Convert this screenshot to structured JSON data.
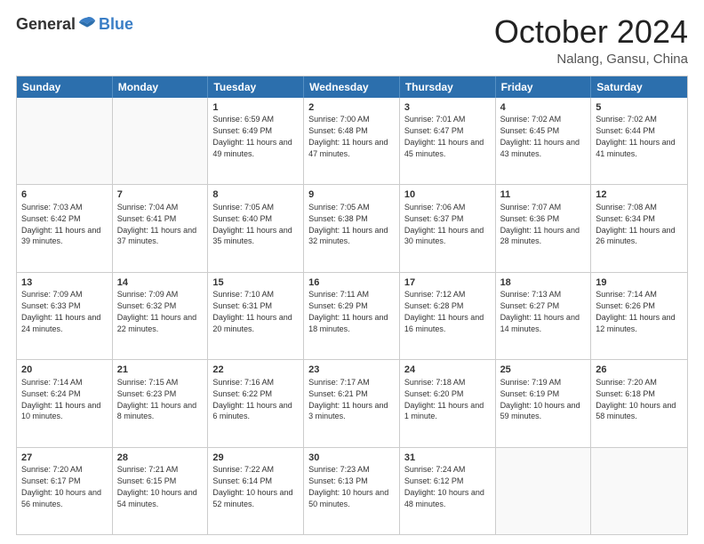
{
  "header": {
    "logo_general": "General",
    "logo_blue": "Blue",
    "month_title": "October 2024",
    "location": "Nalang, Gansu, China"
  },
  "days_of_week": [
    "Sunday",
    "Monday",
    "Tuesday",
    "Wednesday",
    "Thursday",
    "Friday",
    "Saturday"
  ],
  "weeks": [
    [
      {
        "day": "",
        "text": ""
      },
      {
        "day": "",
        "text": ""
      },
      {
        "day": "1",
        "text": "Sunrise: 6:59 AM\nSunset: 6:49 PM\nDaylight: 11 hours and 49 minutes."
      },
      {
        "day": "2",
        "text": "Sunrise: 7:00 AM\nSunset: 6:48 PM\nDaylight: 11 hours and 47 minutes."
      },
      {
        "day": "3",
        "text": "Sunrise: 7:01 AM\nSunset: 6:47 PM\nDaylight: 11 hours and 45 minutes."
      },
      {
        "day": "4",
        "text": "Sunrise: 7:02 AM\nSunset: 6:45 PM\nDaylight: 11 hours and 43 minutes."
      },
      {
        "day": "5",
        "text": "Sunrise: 7:02 AM\nSunset: 6:44 PM\nDaylight: 11 hours and 41 minutes."
      }
    ],
    [
      {
        "day": "6",
        "text": "Sunrise: 7:03 AM\nSunset: 6:42 PM\nDaylight: 11 hours and 39 minutes."
      },
      {
        "day": "7",
        "text": "Sunrise: 7:04 AM\nSunset: 6:41 PM\nDaylight: 11 hours and 37 minutes."
      },
      {
        "day": "8",
        "text": "Sunrise: 7:05 AM\nSunset: 6:40 PM\nDaylight: 11 hours and 35 minutes."
      },
      {
        "day": "9",
        "text": "Sunrise: 7:05 AM\nSunset: 6:38 PM\nDaylight: 11 hours and 32 minutes."
      },
      {
        "day": "10",
        "text": "Sunrise: 7:06 AM\nSunset: 6:37 PM\nDaylight: 11 hours and 30 minutes."
      },
      {
        "day": "11",
        "text": "Sunrise: 7:07 AM\nSunset: 6:36 PM\nDaylight: 11 hours and 28 minutes."
      },
      {
        "day": "12",
        "text": "Sunrise: 7:08 AM\nSunset: 6:34 PM\nDaylight: 11 hours and 26 minutes."
      }
    ],
    [
      {
        "day": "13",
        "text": "Sunrise: 7:09 AM\nSunset: 6:33 PM\nDaylight: 11 hours and 24 minutes."
      },
      {
        "day": "14",
        "text": "Sunrise: 7:09 AM\nSunset: 6:32 PM\nDaylight: 11 hours and 22 minutes."
      },
      {
        "day": "15",
        "text": "Sunrise: 7:10 AM\nSunset: 6:31 PM\nDaylight: 11 hours and 20 minutes."
      },
      {
        "day": "16",
        "text": "Sunrise: 7:11 AM\nSunset: 6:29 PM\nDaylight: 11 hours and 18 minutes."
      },
      {
        "day": "17",
        "text": "Sunrise: 7:12 AM\nSunset: 6:28 PM\nDaylight: 11 hours and 16 minutes."
      },
      {
        "day": "18",
        "text": "Sunrise: 7:13 AM\nSunset: 6:27 PM\nDaylight: 11 hours and 14 minutes."
      },
      {
        "day": "19",
        "text": "Sunrise: 7:14 AM\nSunset: 6:26 PM\nDaylight: 11 hours and 12 minutes."
      }
    ],
    [
      {
        "day": "20",
        "text": "Sunrise: 7:14 AM\nSunset: 6:24 PM\nDaylight: 11 hours and 10 minutes."
      },
      {
        "day": "21",
        "text": "Sunrise: 7:15 AM\nSunset: 6:23 PM\nDaylight: 11 hours and 8 minutes."
      },
      {
        "day": "22",
        "text": "Sunrise: 7:16 AM\nSunset: 6:22 PM\nDaylight: 11 hours and 6 minutes."
      },
      {
        "day": "23",
        "text": "Sunrise: 7:17 AM\nSunset: 6:21 PM\nDaylight: 11 hours and 3 minutes."
      },
      {
        "day": "24",
        "text": "Sunrise: 7:18 AM\nSunset: 6:20 PM\nDaylight: 11 hours and 1 minute."
      },
      {
        "day": "25",
        "text": "Sunrise: 7:19 AM\nSunset: 6:19 PM\nDaylight: 10 hours and 59 minutes."
      },
      {
        "day": "26",
        "text": "Sunrise: 7:20 AM\nSunset: 6:18 PM\nDaylight: 10 hours and 58 minutes."
      }
    ],
    [
      {
        "day": "27",
        "text": "Sunrise: 7:20 AM\nSunset: 6:17 PM\nDaylight: 10 hours and 56 minutes."
      },
      {
        "day": "28",
        "text": "Sunrise: 7:21 AM\nSunset: 6:15 PM\nDaylight: 10 hours and 54 minutes."
      },
      {
        "day": "29",
        "text": "Sunrise: 7:22 AM\nSunset: 6:14 PM\nDaylight: 10 hours and 52 minutes."
      },
      {
        "day": "30",
        "text": "Sunrise: 7:23 AM\nSunset: 6:13 PM\nDaylight: 10 hours and 50 minutes."
      },
      {
        "day": "31",
        "text": "Sunrise: 7:24 AM\nSunset: 6:12 PM\nDaylight: 10 hours and 48 minutes."
      },
      {
        "day": "",
        "text": ""
      },
      {
        "day": "",
        "text": ""
      }
    ]
  ]
}
